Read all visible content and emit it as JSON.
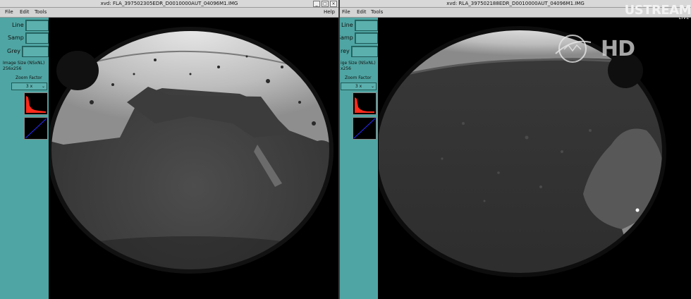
{
  "left_window": {
    "title": "xvd: FLA_397502305EDR_D0010000AUT_04096M1.IMG",
    "menu": {
      "file": "File",
      "edit": "Edit",
      "tools": "Tools",
      "help": "Help"
    },
    "buttons": {
      "minimize": "_",
      "maximize": "□",
      "close": "×"
    },
    "panel": {
      "line_label": "Line",
      "samp_label": "Samp",
      "grey_label": "Grey",
      "image_size_label": "Image Size (NSxNL)",
      "image_size_value": "256x256",
      "zoom_label": "Zoom Factor",
      "zoom_value": "3 x"
    }
  },
  "right_window": {
    "title": "xvd: RLA_397502188EDR_D0010000AUT_04096M1.IMG",
    "menu": {
      "file": "File",
      "edit": "Edit",
      "tools": "Tools"
    },
    "panel": {
      "line_label": "Line",
      "samp_label": "Samp",
      "grey_label": "rey",
      "image_size_label": "ige Size (NSxNL)",
      "image_size_value": "x256",
      "zoom_label": "Zoom Factor",
      "zoom_value": "3 x"
    }
  },
  "overlay": {
    "brand": "USTREAM",
    "live": "LIVE",
    "hd": "HD"
  },
  "colors": {
    "panel": "#4fa5a3",
    "field": "#5bb0ae",
    "histogram": "#ff2a1a",
    "curve": "#2a2aff"
  }
}
